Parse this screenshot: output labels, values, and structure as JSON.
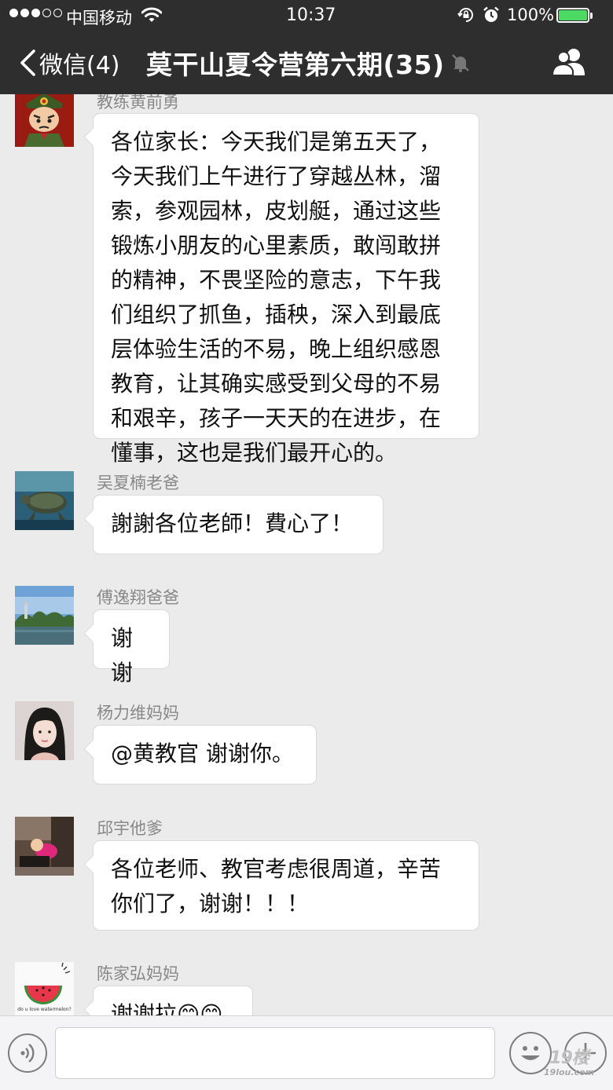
{
  "status_bar": {
    "carrier": "中国移动",
    "time": "10:37",
    "battery_percent": "100%",
    "battery_level": 1.0,
    "signal_bars_filled": 3,
    "signal_bars_total": 5
  },
  "nav": {
    "back_label": "微信(4)",
    "title": "莫干山夏令营第六期(35)",
    "icons": [
      "back-chevron-icon",
      "mute-bell-icon",
      "group-members-icon"
    ]
  },
  "messages": [
    {
      "sender": "教练黄前勇",
      "lines": [
        "各位家长：今天我们是第五天了，",
        "今天我们上午进行了穿越丛林，溜",
        "索，参观园林，皮划艇，通过这些",
        "锻炼小朋友的心里素质，敢闯敢拼",
        "的精神，不畏坚险的意志，下午我",
        "们组织了抓鱼，插秧，深入到最底",
        "层体验生活的不易，晚上组织感恩",
        "教育，让其确实感受到父母的不易",
        "和艰辛，孩子一天天的在进步，在",
        "懂事，这也是我们最开心的。"
      ]
    },
    {
      "sender": "吴夏楠老爸",
      "lines": [
        "謝謝各位老師！費心了！"
      ]
    },
    {
      "sender": "傅逸翔爸爸",
      "lines": [
        "谢谢"
      ]
    },
    {
      "sender": "杨力维妈妈",
      "lines": [
        "@黄教官 谢谢你。"
      ]
    },
    {
      "sender": "邱宇他爹",
      "lines": [
        "各位老师、教官考虑很周道，辛苦",
        "你们了，谢谢！！！"
      ]
    },
    {
      "sender": "陈家弘妈妈",
      "lines": [
        "谢谢拉😊😊"
      ]
    }
  ],
  "avatar_captions": {
    "watermelon": "do u love watermelon?"
  },
  "input_bar": {
    "placeholder": "",
    "icons": [
      "voice-icon",
      "emoji-icon",
      "plus-icon"
    ]
  },
  "watermark": {
    "big": "19楼",
    "small": "19lou.com"
  },
  "colors": {
    "nav_bg": "#2e2e2e",
    "chat_bg": "#ebebeb",
    "battery": "#4cd964"
  }
}
